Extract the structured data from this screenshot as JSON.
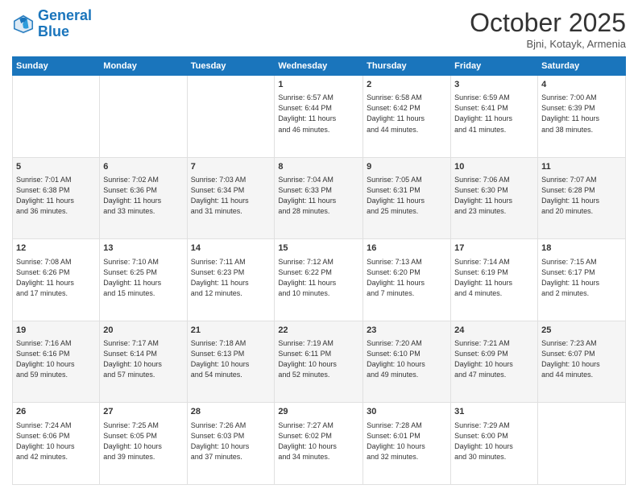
{
  "logo": {
    "line1": "General",
    "line2": "Blue"
  },
  "title": "October 2025",
  "subtitle": "Bjni, Kotayk, Armenia",
  "days_of_week": [
    "Sunday",
    "Monday",
    "Tuesday",
    "Wednesday",
    "Thursday",
    "Friday",
    "Saturday"
  ],
  "weeks": [
    [
      {
        "day": "",
        "info": ""
      },
      {
        "day": "",
        "info": ""
      },
      {
        "day": "",
        "info": ""
      },
      {
        "day": "1",
        "info": "Sunrise: 6:57 AM\nSunset: 6:44 PM\nDaylight: 11 hours\nand 46 minutes."
      },
      {
        "day": "2",
        "info": "Sunrise: 6:58 AM\nSunset: 6:42 PM\nDaylight: 11 hours\nand 44 minutes."
      },
      {
        "day": "3",
        "info": "Sunrise: 6:59 AM\nSunset: 6:41 PM\nDaylight: 11 hours\nand 41 minutes."
      },
      {
        "day": "4",
        "info": "Sunrise: 7:00 AM\nSunset: 6:39 PM\nDaylight: 11 hours\nand 38 minutes."
      }
    ],
    [
      {
        "day": "5",
        "info": "Sunrise: 7:01 AM\nSunset: 6:38 PM\nDaylight: 11 hours\nand 36 minutes."
      },
      {
        "day": "6",
        "info": "Sunrise: 7:02 AM\nSunset: 6:36 PM\nDaylight: 11 hours\nand 33 minutes."
      },
      {
        "day": "7",
        "info": "Sunrise: 7:03 AM\nSunset: 6:34 PM\nDaylight: 11 hours\nand 31 minutes."
      },
      {
        "day": "8",
        "info": "Sunrise: 7:04 AM\nSunset: 6:33 PM\nDaylight: 11 hours\nand 28 minutes."
      },
      {
        "day": "9",
        "info": "Sunrise: 7:05 AM\nSunset: 6:31 PM\nDaylight: 11 hours\nand 25 minutes."
      },
      {
        "day": "10",
        "info": "Sunrise: 7:06 AM\nSunset: 6:30 PM\nDaylight: 11 hours\nand 23 minutes."
      },
      {
        "day": "11",
        "info": "Sunrise: 7:07 AM\nSunset: 6:28 PM\nDaylight: 11 hours\nand 20 minutes."
      }
    ],
    [
      {
        "day": "12",
        "info": "Sunrise: 7:08 AM\nSunset: 6:26 PM\nDaylight: 11 hours\nand 17 minutes."
      },
      {
        "day": "13",
        "info": "Sunrise: 7:10 AM\nSunset: 6:25 PM\nDaylight: 11 hours\nand 15 minutes."
      },
      {
        "day": "14",
        "info": "Sunrise: 7:11 AM\nSunset: 6:23 PM\nDaylight: 11 hours\nand 12 minutes."
      },
      {
        "day": "15",
        "info": "Sunrise: 7:12 AM\nSunset: 6:22 PM\nDaylight: 11 hours\nand 10 minutes."
      },
      {
        "day": "16",
        "info": "Sunrise: 7:13 AM\nSunset: 6:20 PM\nDaylight: 11 hours\nand 7 minutes."
      },
      {
        "day": "17",
        "info": "Sunrise: 7:14 AM\nSunset: 6:19 PM\nDaylight: 11 hours\nand 4 minutes."
      },
      {
        "day": "18",
        "info": "Sunrise: 7:15 AM\nSunset: 6:17 PM\nDaylight: 11 hours\nand 2 minutes."
      }
    ],
    [
      {
        "day": "19",
        "info": "Sunrise: 7:16 AM\nSunset: 6:16 PM\nDaylight: 10 hours\nand 59 minutes."
      },
      {
        "day": "20",
        "info": "Sunrise: 7:17 AM\nSunset: 6:14 PM\nDaylight: 10 hours\nand 57 minutes."
      },
      {
        "day": "21",
        "info": "Sunrise: 7:18 AM\nSunset: 6:13 PM\nDaylight: 10 hours\nand 54 minutes."
      },
      {
        "day": "22",
        "info": "Sunrise: 7:19 AM\nSunset: 6:11 PM\nDaylight: 10 hours\nand 52 minutes."
      },
      {
        "day": "23",
        "info": "Sunrise: 7:20 AM\nSunset: 6:10 PM\nDaylight: 10 hours\nand 49 minutes."
      },
      {
        "day": "24",
        "info": "Sunrise: 7:21 AM\nSunset: 6:09 PM\nDaylight: 10 hours\nand 47 minutes."
      },
      {
        "day": "25",
        "info": "Sunrise: 7:23 AM\nSunset: 6:07 PM\nDaylight: 10 hours\nand 44 minutes."
      }
    ],
    [
      {
        "day": "26",
        "info": "Sunrise: 7:24 AM\nSunset: 6:06 PM\nDaylight: 10 hours\nand 42 minutes."
      },
      {
        "day": "27",
        "info": "Sunrise: 7:25 AM\nSunset: 6:05 PM\nDaylight: 10 hours\nand 39 minutes."
      },
      {
        "day": "28",
        "info": "Sunrise: 7:26 AM\nSunset: 6:03 PM\nDaylight: 10 hours\nand 37 minutes."
      },
      {
        "day": "29",
        "info": "Sunrise: 7:27 AM\nSunset: 6:02 PM\nDaylight: 10 hours\nand 34 minutes."
      },
      {
        "day": "30",
        "info": "Sunrise: 7:28 AM\nSunset: 6:01 PM\nDaylight: 10 hours\nand 32 minutes."
      },
      {
        "day": "31",
        "info": "Sunrise: 7:29 AM\nSunset: 6:00 PM\nDaylight: 10 hours\nand 30 minutes."
      },
      {
        "day": "",
        "info": ""
      }
    ]
  ]
}
